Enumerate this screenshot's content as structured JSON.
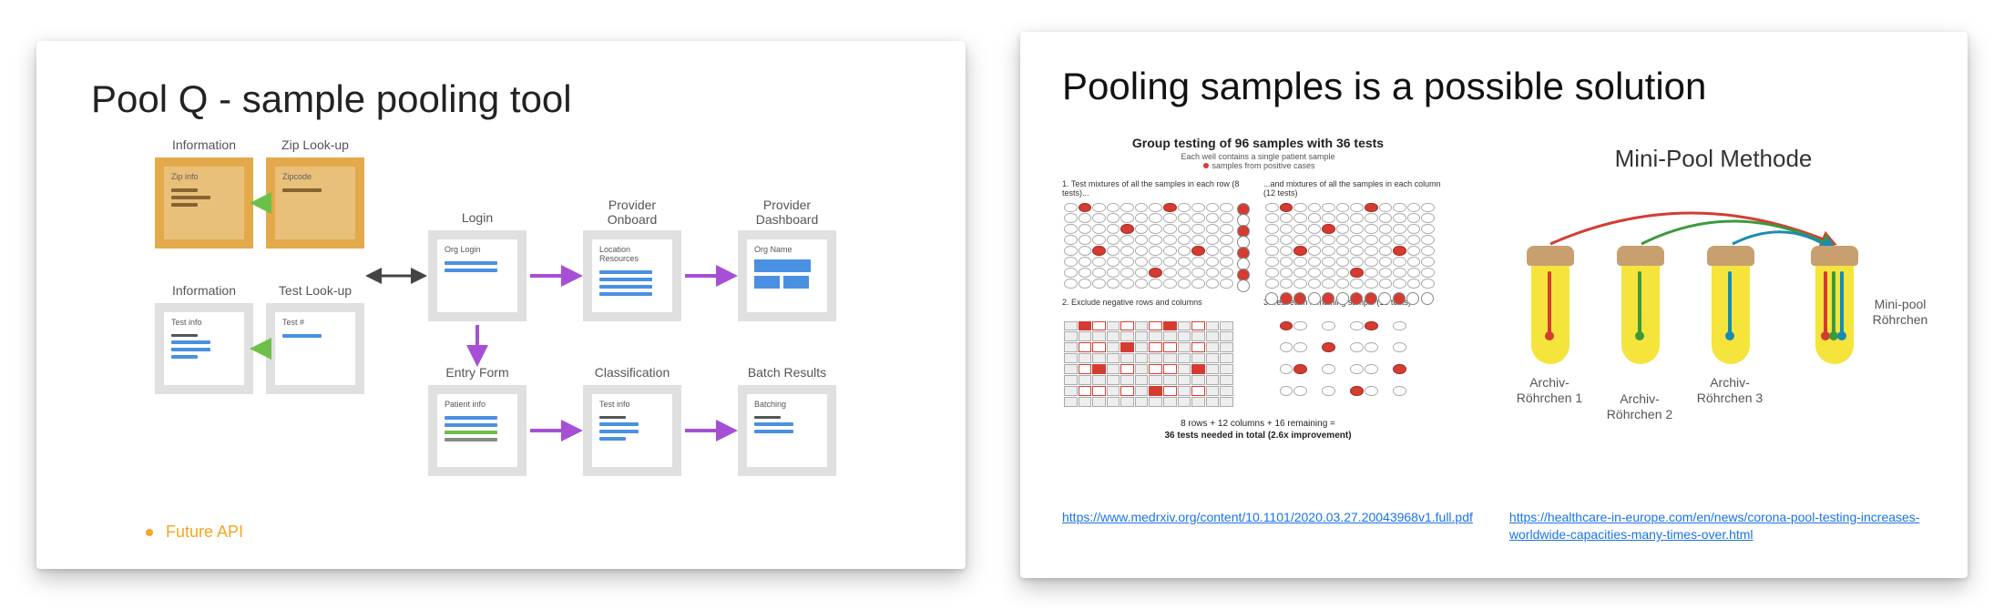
{
  "slide_left": {
    "title": "Pool Q - sample pooling tool",
    "future_api": "Future API",
    "boxes": {
      "info1": {
        "cap": "Information",
        "ititle": "Zip info"
      },
      "zip": {
        "cap": "Zip Look-up",
        "ititle": "Zipcode"
      },
      "info2": {
        "cap": "Information",
        "ititle": "Test info"
      },
      "test": {
        "cap": "Test Look-up",
        "ititle": "Test #"
      },
      "login": {
        "cap": "Login",
        "ititle": "Org Login"
      },
      "entry": {
        "cap": "Entry Form",
        "ititle": "Patient info"
      },
      "onboard": {
        "cap": "Provider Onboard",
        "ititle": "Location Resources"
      },
      "class": {
        "cap": "Classification",
        "ititle": "Test info"
      },
      "dash": {
        "cap": "Provider Dashboard",
        "ititle": "Org Name"
      },
      "batch": {
        "cap": "Batch Results",
        "ititle": "Batching"
      }
    }
  },
  "slide_right": {
    "title": "Pooling samples is a possible solution",
    "gt_title": "Group testing of 96 samples with 36 tests",
    "gt_sub1": "Each well contains a single patient sample",
    "gt_sub2": "samples from positive cases",
    "step1a": "1. Test mixtures of all the samples in each row (8 tests)...",
    "step1b": "...and mixtures of all the samples in each column (12 tests)",
    "step2": "2. Exclude negative rows and columns",
    "step3": "3. Test each remaining sample (16 tests)",
    "foot1": "8 rows + 12 columns + 16 remaining =",
    "foot2": "36 tests needed in total (2.6x improvement)",
    "mp_title": "Mini-Pool Methode",
    "tube_labels": {
      "t1": "Archiv-Röhrchen 1",
      "t2": "Archiv-Röhrchen 2",
      "t3": "Archiv-Röhrchen 3",
      "t4": "Mini-pool Röhrchen"
    },
    "links": {
      "l1": "https://www.medrxiv.org/content/10.1101/2020.03.27.20043968v1.full.pdf",
      "l2": "https://healthcare-in-europe.com/en/news/corona-pool-testing-increases-worldwide-capacities-many-times-over.html"
    }
  }
}
